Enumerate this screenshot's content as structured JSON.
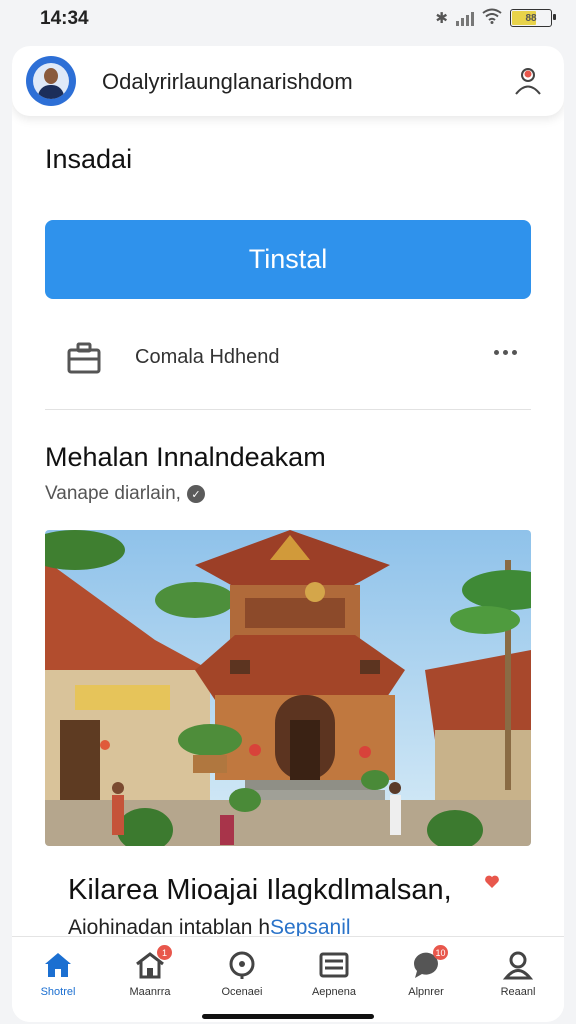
{
  "status_bar": {
    "time": "14:34",
    "battery": "88"
  },
  "header": {
    "title": "Odalyrirlaunglanarishdom"
  },
  "section": {
    "heading": "Insadai"
  },
  "install_button": {
    "label": "Tinstal"
  },
  "company": {
    "name": "Comala Hdhend"
  },
  "post": {
    "title": "Mehalan Innalndeakam",
    "meta": "Vanape diarlain,"
  },
  "caption": {
    "title": "Kilarea Mioajai Ilagkdlmalsan,",
    "subtitle_plain": "Aiohinadan intablan h",
    "subtitle_link": "Sepsanil"
  },
  "bottom_nav": [
    {
      "label": "Shotrel",
      "icon": "home-icon",
      "active": true
    },
    {
      "label": "Maanrra",
      "icon": "house-icon",
      "badge": "1"
    },
    {
      "label": "Ocenaei",
      "icon": "search-icon"
    },
    {
      "label": "Aepnena",
      "icon": "menu-icon"
    },
    {
      "label": "Alpnrer",
      "icon": "chat-icon",
      "badge": "10"
    },
    {
      "label": "Reaanl",
      "icon": "profile-icon"
    }
  ],
  "colors": {
    "accent": "#2f92ec",
    "link": "#2a73c9",
    "badge": "#e8574c",
    "active_nav": "#1b6fd1"
  }
}
